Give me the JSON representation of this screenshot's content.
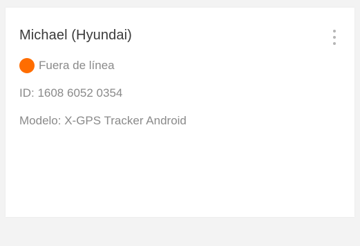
{
  "device": {
    "name": "Michael (Hyundai)",
    "status": {
      "label": "Fuera de línea",
      "color": "#ff6d00"
    },
    "id_text": "ID: 1608 6052 0354",
    "model_text": "Modelo: X-GPS Tracker Android"
  },
  "menu": {
    "icon": "more-vertical-icon"
  },
  "colors": {
    "background": "#f3f3f3",
    "card": "#ffffff",
    "title_text": "#3a3a3a",
    "secondary_text": "#8a8a8a",
    "offline": "#ff6d00"
  }
}
